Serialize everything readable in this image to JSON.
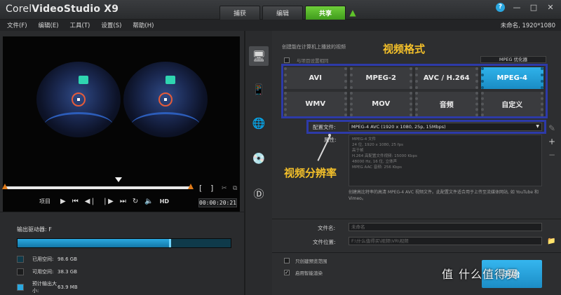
{
  "titlebar": {
    "brand_prefix": "Corel",
    "brand_name": "VideoStudio X9",
    "steps": [
      "捕获",
      "编辑",
      "共享"
    ],
    "active_step": "共享",
    "help": "?"
  },
  "menu": {
    "items": [
      "文件(F)",
      "编辑(E)",
      "工具(T)",
      "设置(S)",
      "帮助(H)"
    ],
    "project": "未命名, 1920*1080"
  },
  "player": {
    "project_label": "项目",
    "hd_label": "HD",
    "timecode": "00:00:20:21"
  },
  "drive": {
    "title": "输出驱动器: F",
    "used_fraction": 0.71,
    "legend": [
      {
        "label": "已用空间:",
        "value": "98.6 GB",
        "color": "#0f3a4a"
      },
      {
        "label": "可用空间:",
        "value": "38.3 GB",
        "color": "#1b1c1d"
      },
      {
        "label": "预计输出大小:",
        "value": "63.9 MB",
        "color": "#2aa8e0"
      }
    ]
  },
  "share": {
    "caption": "创建能在计算机上播放的视频",
    "checkbox_label": "与项目设置相同",
    "optimizer": "MPEG 优化器",
    "formats_row1": [
      "AVI",
      "MPEG-2",
      "AVC / H.264",
      "MPEG-4"
    ],
    "formats_row2": [
      "WMV",
      "MOV",
      "音频",
      "自定义"
    ],
    "active_format": "MPEG-4",
    "config_label": "配置文件:",
    "config_value": "MPEG-4 AVC (1920 x 1080, 25p, 15Mbps)",
    "props_label": "属性:",
    "props": [
      "MPEG-4 文件",
      "24 位, 1920 x 1080, 25 fps",
      "高于帧",
      "H.264 高配置文件视频: 15000 Kbps",
      "48000 Hz, 16 位, 立体声",
      "MPEG AAC 音频: 256 Kbps"
    ],
    "description": "创建高比特率的高清 MPEG-4 AVC 视频文件。此配置文件适合用于上传至流媒体网站, 如 YouTube 和 Vimeo。",
    "filename_label": "文件名:",
    "filename_placeholder": "未命名",
    "location_label": "文件位置:",
    "location_placeholder": "F:\\什么值得买\\视频\\VR\\视频",
    "opt1": "只创建预览范围",
    "opt2": "启用智能渲染",
    "start_label": "开始"
  },
  "annotations": {
    "format_label": "视频格式",
    "resolution_label": "视频分辨率"
  },
  "watermark": {
    "main": "值",
    "rest": "什么值得买"
  }
}
